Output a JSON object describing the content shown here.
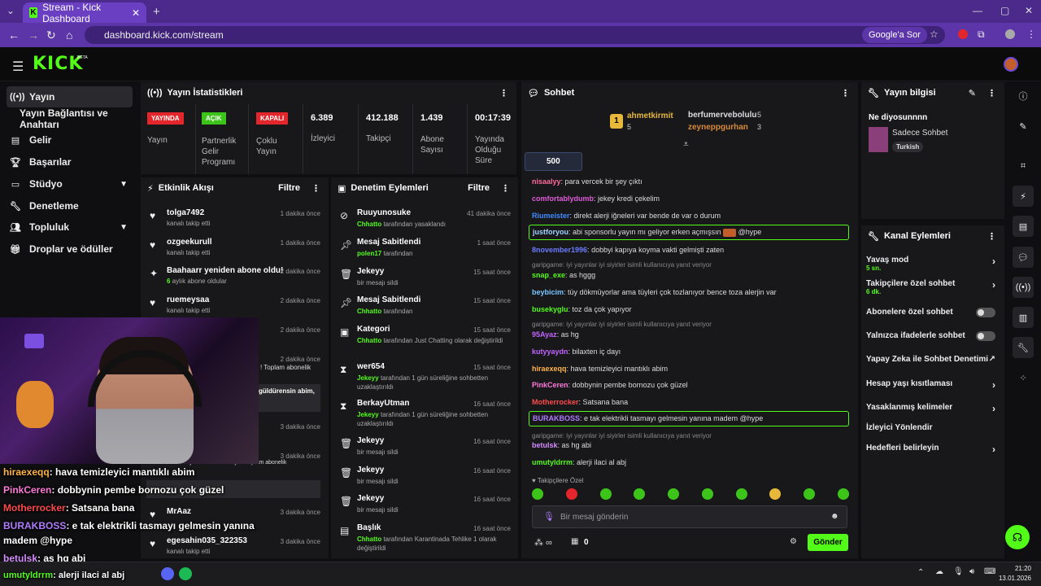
{
  "browser": {
    "tab_title": "Stream - Kick Dashboard",
    "url": "dashboard.kick.com/stream",
    "google_btn": "Google'a Sor"
  },
  "app": {
    "logo": "KICK",
    "beta": "BETA"
  },
  "sidebar": {
    "items": [
      {
        "label": "Yayın",
        "icon": "stream-icon"
      },
      {
        "label": "Yayın Bağlantısı ve Anahtarı",
        "icon": ""
      },
      {
        "label": "Gelir",
        "icon": "revenue-icon"
      },
      {
        "label": "Başarılar",
        "icon": "trophy-icon"
      },
      {
        "label": "Stüdyo",
        "icon": "studio-icon"
      },
      {
        "label": "Denetleme",
        "icon": "wrench-icon"
      },
      {
        "label": "Topluluk",
        "icon": "community-icon"
      },
      {
        "label": "Droplar ve ödüller",
        "icon": "gift-icon"
      }
    ]
  },
  "stats": {
    "title": "Yayın İstatistikleri",
    "items": [
      {
        "badge": "YAYINDA",
        "badge_color": "#e3262b",
        "label": "Yayın"
      },
      {
        "badge": "AÇIK",
        "badge_color": "#3dc41a",
        "label": "Partnerlik Gelir Programı"
      },
      {
        "badge": "KAPALI",
        "badge_color": "#e3262b",
        "label": "Çoklu Yayın"
      },
      {
        "value": "6.389",
        "label": "İzleyici"
      },
      {
        "value": "412.188",
        "label": "Takipçi"
      },
      {
        "value": "1.439",
        "label": "Abone Sayısı"
      },
      {
        "value": "00:17:39",
        "label": "Yayında Olduğu Süre"
      }
    ]
  },
  "activity": {
    "title": "Etkinlik Akışı",
    "filter": "Filtre",
    "items": [
      {
        "name": "tolga7492",
        "sub": "kanalı takip etti",
        "time": "1 dakika önce"
      },
      {
        "name": "ozgeekurull",
        "sub": "kanalı takip etti",
        "time": "1 dakika önce"
      },
      {
        "name": "Baahaarr yeniden abone oldu!",
        "sub_bold": "6",
        "sub": " aylık abone oldular",
        "time": "2 dakika önce"
      },
      {
        "name": "ruemeysaa",
        "sub": "kanalı takip etti",
        "time": "2 dakika önce"
      },
      {
        "name": "",
        "sub": "",
        "time": "2 dakika önce"
      },
      {
        "name": "",
        "sub": "! Toplam abonelik",
        "time": "2 dakika önce"
      },
      {
        "name": "güldürensin abim,",
        "sub": "",
        "time": ""
      },
      {
        "name": "",
        "sub": "",
        "time": "3 dakika önce"
      },
      {
        "name": "",
        "sub": "abonelik yenilemesini kutluyor! Toplam abonelik",
        "time": "3 dakika önce"
      },
      {
        "name": "MrAaz",
        "sub": "",
        "time": "3 dakika önce"
      },
      {
        "name": "egesahin035_322353",
        "sub": "kanalı takip etti",
        "time": "3 dakika önce"
      }
    ]
  },
  "moderation": {
    "title": "Denetim Eylemleri",
    "filter": "Filtre",
    "items": [
      {
        "name": "Ruuyunosuke",
        "who": "Chhatto",
        "sub": "tarafından yasaklandı",
        "time": "41 dakika önce"
      },
      {
        "name": "Mesaj Sabitlendi",
        "who": "polen17",
        "sub": "tarafından",
        "time": "1 saat önce"
      },
      {
        "name": "Jekeyy",
        "who": "",
        "sub": "bir mesajı sildi",
        "time": "15 saat önce"
      },
      {
        "name": "Mesaj Sabitlendi",
        "who": "Chhatto",
        "sub": "tarafından",
        "time": "15 saat önce"
      },
      {
        "name": "Kategori",
        "who": "Chhatto",
        "sub": "tarafından Just Chatting olarak değiştirildi",
        "time": "15 saat önce"
      },
      {
        "name": "wer654",
        "who": "Jekeyy",
        "sub": "tarafından 1 gün süreliğine sohbetten uzaklaştırıldı",
        "time": "15 saat önce"
      },
      {
        "name": "BerkayUtman",
        "who": "Jekeyy",
        "sub": "tarafından 1 gün süreliğine sohbetten uzaklaştırıldı",
        "time": "16 saat önce"
      },
      {
        "name": "Jekeyy",
        "who": "",
        "sub": "bir mesajı sildi",
        "time": "16 saat önce"
      },
      {
        "name": "Jekeyy",
        "who": "",
        "sub": "bir mesajı sildi",
        "time": "16 saat önce"
      },
      {
        "name": "Jekeyy",
        "who": "",
        "sub": "bir mesajı sildi",
        "time": "16 saat önce"
      },
      {
        "name": "Başlık",
        "who": "Chhatto",
        "sub": "tarafından Karantinada Tehlike 1 olarak değiştirildi",
        "time": "16 saat önce"
      }
    ]
  },
  "chat": {
    "title": "Sohbet",
    "top": [
      {
        "rank": "1",
        "name": "ahmetkirmit",
        "count": "5"
      },
      {
        "name": "berfumervebolulu",
        "count": "5"
      },
      {
        "name": "zeyneppgurhan",
        "count": "3"
      }
    ],
    "gift_count": "500",
    "messages": [
      {
        "user": "nisaalyy",
        "color": "#ff6a9a",
        "text": "para vercek bir şey çıktı"
      },
      {
        "user": "comfortablydumb",
        "color": "#e05ad8",
        "text": "jekey kredi çekelim"
      },
      {
        "user": "Riumeister",
        "color": "#3f8cff",
        "text": "direkt alerji iğneleri var bende de var o durum"
      },
      {
        "user": "justforyou",
        "color": "#9fd3ff",
        "text": "abi sponsorlu yayın mı geliyor erken açmışsın",
        "tail": "@hype"
      },
      {
        "user": "8november1996",
        "color": "#6a7cff",
        "text": "dobbyi kapıya koyma vakti gelmişti zaten"
      },
      {
        "reply": "garipgame: iyi yayınlar iyi siyirler isimli kullanıcıya yanıt veriyor"
      },
      {
        "user": "snap_exe",
        "color": "#53fc18",
        "text": "as hggg"
      },
      {
        "user": "beybicim",
        "color": "#79c7ff",
        "text": "tüy dökmüyorlar ama tüyleri çok tozlanıyor bence toza alerjin var"
      },
      {
        "user": "busekyglu",
        "color": "#53fc18",
        "text": "toz da çok yapıyor"
      },
      {
        "reply": "garipgame: iyi yayınlar iyi siyirler isimli kullanıcıya yanıt veriyor"
      },
      {
        "user": "95Ayaz",
        "color": "#c063ff",
        "text": "as hg"
      },
      {
        "user": "kutyyaydn",
        "color": "#c063ff",
        "text": "bilaxten iç dayı"
      },
      {
        "user": "hiraexeqq",
        "color": "#ffb347",
        "text": "hava temizleyici mantıklı abim"
      },
      {
        "user": "PinkCeren",
        "color": "#ff7ad9",
        "text": "dobbynin pembe bornozu çok güzel"
      },
      {
        "user": "Motherrocker",
        "color": "#ff4a4a",
        "text": "Satsana bana"
      },
      {
        "user": "BURAKBOSS",
        "color": "#b07cff",
        "text": "e tak elektrikli tasmayı gelmesin yanına madem @hype"
      },
      {
        "reply": "garipgame: iyi yayınlar iyi siyirler isimli kullanıcıya yanıt veriyor"
      },
      {
        "user": "betulsk",
        "color": "#d58cff",
        "text": "as hg abi"
      },
      {
        "user": "umutyldrrm",
        "color": "#53fc18",
        "text": "alerji ilaci al abj"
      }
    ],
    "followers_only": "Takipçilere Özel",
    "input_placeholder": "Bir mesaj gönderin",
    "points": "0",
    "send": "Gönder"
  },
  "info": {
    "title": "Yayın bilgisi",
    "stream_title": "Ne diyosunnnn",
    "category": "Sadece Sohbet",
    "tag": "Turkish"
  },
  "channel": {
    "title": "Kanal Eylemleri",
    "items": [
      {
        "label": "Yavaş mod",
        "sub": "5 sn.",
        "type": "arrow"
      },
      {
        "label": "Takipçilere özel sohbet",
        "sub": "6 dk.",
        "type": "arrow"
      },
      {
        "label": "Abonelere özel sohbet",
        "type": "toggle"
      },
      {
        "label": "Yalnızca ifadelerle sohbet",
        "type": "toggle"
      },
      {
        "label": "Yapay Zeka ile Sohbet Denetimi",
        "type": "external"
      },
      {
        "label": "Hesap yaşı kısıtlaması",
        "type": "arrow"
      },
      {
        "label": "Yasaklanmış kelimeler",
        "type": "arrow"
      },
      {
        "label": "İzleyici Yönlendir",
        "type": "none"
      },
      {
        "label": "Hedefleri belirleyin",
        "type": "arrow"
      }
    ]
  },
  "overlay": [
    {
      "user": "hiraexeqq",
      "color": "#ffb347",
      "text": ": hava temizleyici mantıklı abim"
    },
    {
      "user": "PinkCeren",
      "color": "#ff7ad9",
      "text": ": dobbynin pembe bornozu çok güzel"
    },
    {
      "user": "Motherrocker",
      "color": "#ff4a4a",
      "text": ": Satsana bana"
    },
    {
      "user": "BURAKBOSS",
      "color": "#b07cff",
      "text": ": e tak elektrikli tasmayı gelmesin yanına"
    },
    {
      "user": "",
      "color": "#fff",
      "text": "madem @hype"
    },
    {
      "user": "betulsk",
      "color": "#d58cff",
      "text": ": as hg abi"
    },
    {
      "user": "umutyldrrm",
      "color": "#53fc18",
      "text": ": alerji ilaci al abj"
    }
  ],
  "taskbar": {
    "time": "21:20",
    "date": "13.01.2026"
  }
}
